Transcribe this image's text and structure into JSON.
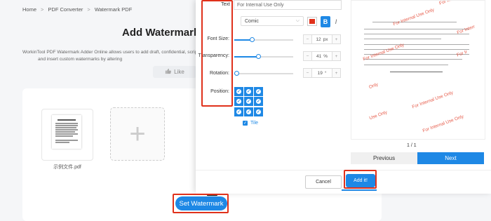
{
  "breadcrumb": {
    "home": "Home",
    "converter": "PDF Converter",
    "current": "Watermark PDF",
    "separator": ">"
  },
  "page": {
    "title": "Add Watermark",
    "description_line1": "WorkinTool PDF Watermark Adder Online allows users to add draft, confidential, scrip",
    "description_line2": "and insert custom watermarks by altering",
    "like_label": "Like",
    "file_name": "示例文件.pdf",
    "add_symbol": "+",
    "set_watermark_label": "Set Watermark"
  },
  "modal": {
    "text_label": "Text",
    "text_value": "For Internal Use Only",
    "font_value": "Comic",
    "font_chevron": "⌵",
    "bold_label": "B",
    "italic_label": "I",
    "color_value": "#e0311b",
    "font_size": {
      "label": "Font Size:",
      "value": "12",
      "unit": "px",
      "level": 0.3
    },
    "transparency": {
      "label": "Transparency:",
      "value": "41",
      "unit": "%",
      "level": 0.41
    },
    "rotation": {
      "label": "Rotation:",
      "value": "19",
      "unit": "°",
      "level": 0.0
    },
    "minus": "−",
    "plus": "+",
    "position_label": "Position:",
    "tile_label": "Tile",
    "cancel_label": "Cancel",
    "add_label": "Add it!"
  },
  "preview": {
    "watermark_text": "For Internal Use Only",
    "wm_partial_1": "For In",
    "wm_partial_2": "Only",
    "wm_partial_3": "Use Only",
    "wm_partial_4": "For Interr",
    "wm_partial_5": "For Ir",
    "page_indicator": "1 / 1",
    "prev_label": "Previous",
    "next_label": "Next"
  },
  "colors": {
    "accent": "#1e88e5",
    "highlight": "#e0311b"
  }
}
